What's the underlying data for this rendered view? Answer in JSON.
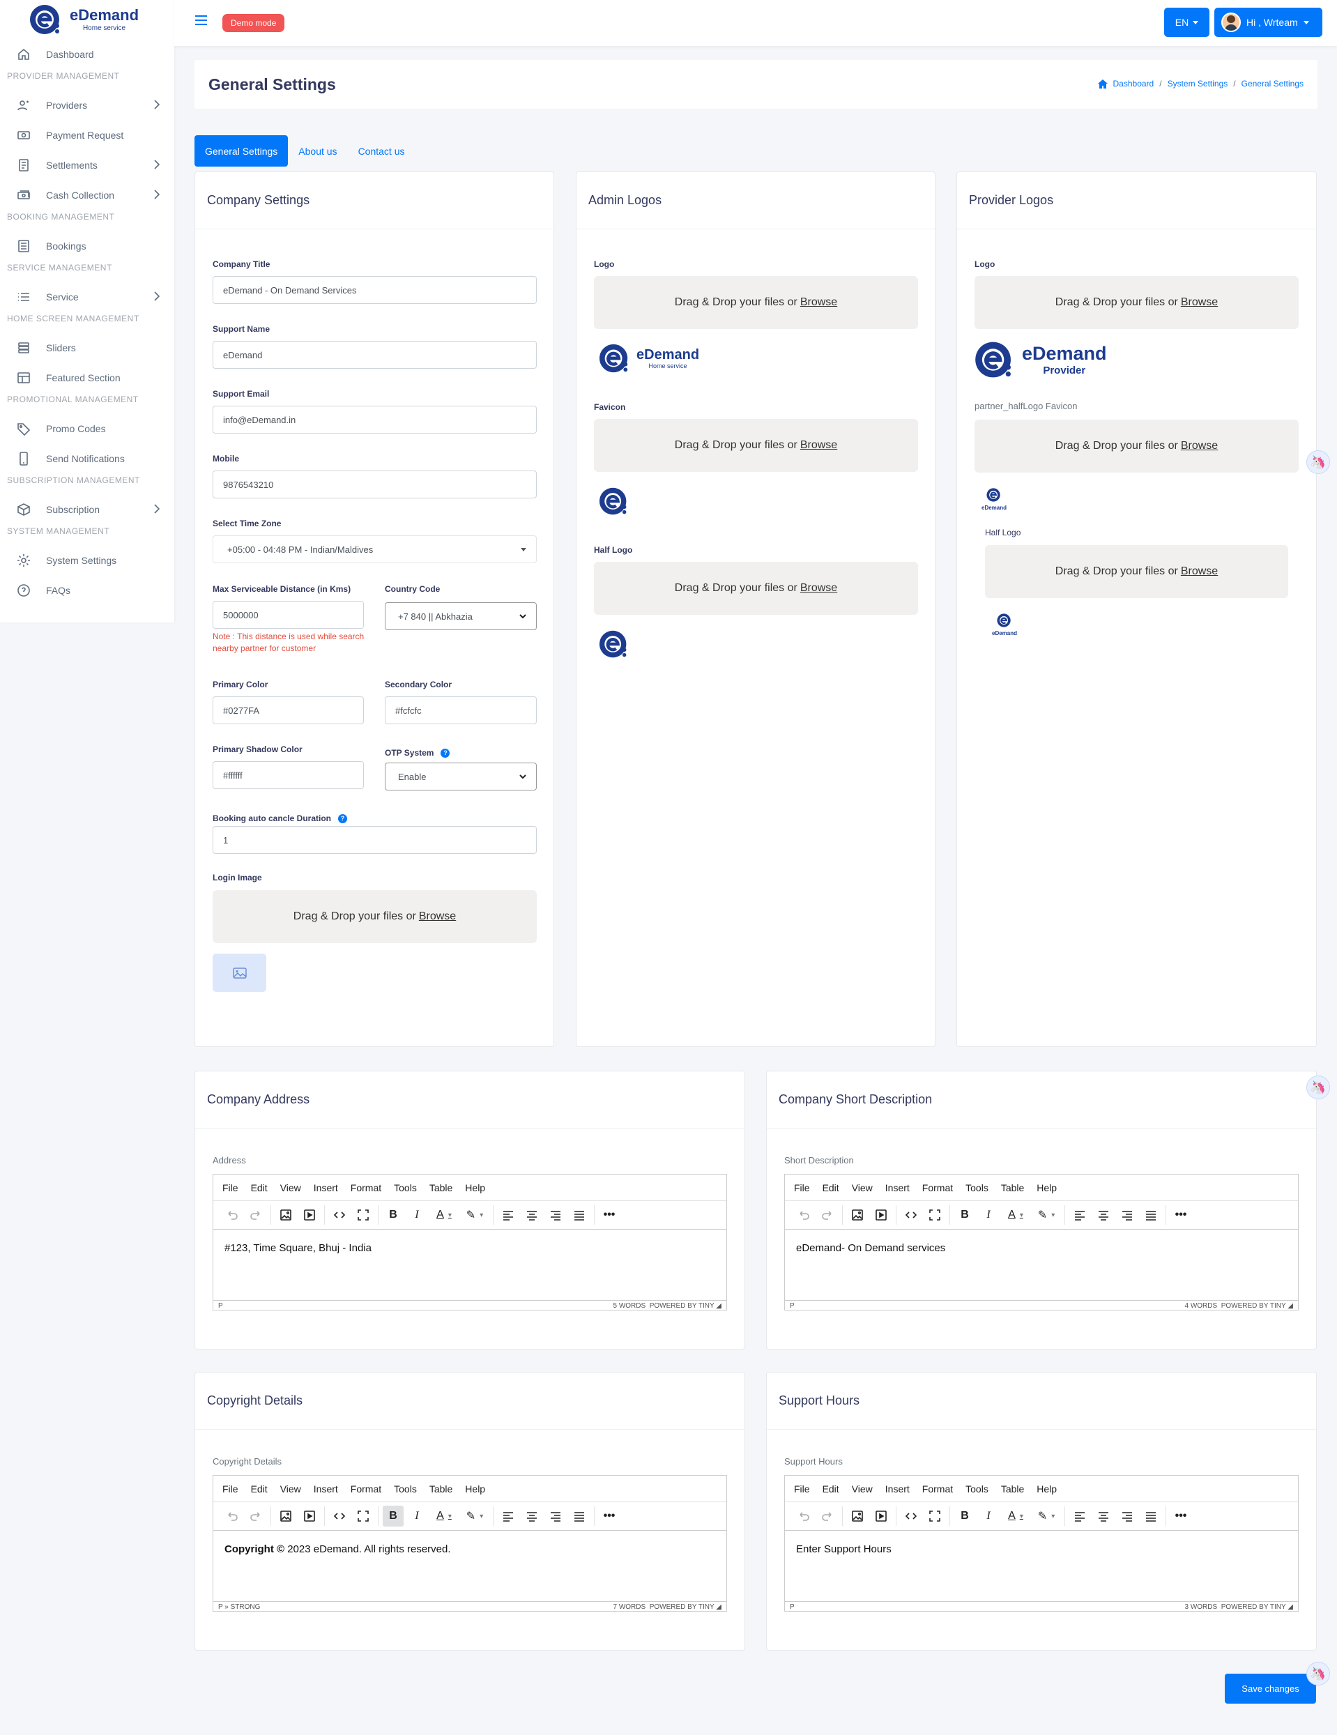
{
  "brand": {
    "name": "eDemand",
    "sub": "Home service"
  },
  "sidebar": {
    "dashboard": "Dashboard",
    "sections": [
      {
        "title": "PROVIDER MANAGEMENT",
        "items": [
          "Providers",
          "Payment Request",
          "Settlements",
          "Cash Collection"
        ]
      },
      {
        "title": "BOOKING MANAGEMENT",
        "items": [
          "Bookings"
        ]
      },
      {
        "title": "SERVICE MANAGEMENT",
        "items": [
          "Service"
        ]
      },
      {
        "title": "HOME SCREEN MANAGEMENT",
        "items": [
          "Sliders",
          "Featured Section"
        ]
      },
      {
        "title": "PROMOTIONAL MANAGEMENT",
        "items": [
          "Promo Codes",
          "Send Notifications"
        ]
      },
      {
        "title": "SUBSCRIPTION MANAGEMENT",
        "items": [
          "Subscription"
        ]
      },
      {
        "title": "SYSTEM MANAGEMENT",
        "items": [
          "System Settings",
          "FAQs"
        ]
      }
    ]
  },
  "topbar": {
    "demo": "Demo mode",
    "lang": "EN",
    "user": "Hi , Wrteam"
  },
  "page": {
    "title": "General Settings",
    "breadcrumb": [
      "Dashboard",
      "System Settings",
      "General Settings"
    ]
  },
  "tabs": [
    "General Settings",
    "About us",
    "Contact us"
  ],
  "company": {
    "heading": "Company Settings",
    "title_label": "Company Title",
    "title_value": "eDemand - On Demand Services",
    "support_name_label": "Support Name",
    "support_name_value": "eDemand",
    "support_email_label": "Support Email",
    "support_email_value": "info@eDemand.in",
    "mobile_label": "Mobile",
    "mobile_value": "9876543210",
    "tz_label": "Select Time Zone",
    "tz_value": "+05:00 - 04:48 PM - Indian/Maldives",
    "distance_label": "Max Serviceable Distance (in Kms)",
    "distance_value": "5000000",
    "distance_note": "Note : This distance is used while search nearby partner for customer",
    "country_label": "Country Code",
    "country_value": "+7 840 || Abkhazia",
    "primary_label": "Primary Color",
    "primary_value": "#0277FA",
    "secondary_label": "Secondary Color",
    "secondary_value": "#fcfcfc",
    "shadow_label": "Primary Shadow Color",
    "shadow_value": "#ffffff",
    "otp_label": "OTP System",
    "otp_value": "Enable",
    "cancel_label": "Booking auto cancle Duration",
    "cancel_value": "1",
    "login_image_label": "Login Image"
  },
  "drop": {
    "text": "Drag & Drop your files or",
    "browse": "Browse"
  },
  "admin_logos": {
    "heading": "Admin Logos",
    "logo": "Logo",
    "favicon": "Favicon",
    "half": "Half Logo"
  },
  "provider_logos": {
    "heading": "Provider Logos",
    "logo": "Logo",
    "brand": "eDemand",
    "brand_sub": "Provider",
    "favicon": "partner_halfLogo Favicon",
    "half": "Half Logo",
    "mini": "eDemand"
  },
  "editor_menu": [
    "File",
    "Edit",
    "View",
    "Insert",
    "Format",
    "Tools",
    "Table",
    "Help"
  ],
  "editors": [
    {
      "heading": "Company Address",
      "label": "Address",
      "content": "#123, Time Square, Bhuj - India",
      "path": "P",
      "words": "5 WORDS",
      "powered": "POWERED BY TINY"
    },
    {
      "heading": "Company Short Description",
      "label": "Short Description",
      "content": "eDemand- On Demand services",
      "path": "P",
      "words": "4 WORDS",
      "powered": "POWERED BY TINY"
    },
    {
      "heading": "Copyright Details",
      "label": "Copyright Details",
      "content_bold": "Copyright ©",
      "content": " 2023 eDemand. All rights reserved.",
      "path": "P » STRONG",
      "words": "7 WORDS",
      "powered": "POWERED BY TINY"
    },
    {
      "heading": "Support Hours",
      "label": "Support Hours",
      "content": "Enter Support Hours",
      "path": "P",
      "words": "3 WORDS",
      "powered": "POWERED BY TINY"
    }
  ],
  "save": "Save changes",
  "colors": {
    "accent": "#0277fa",
    "brand": "#1d3c8f",
    "demo": "#f05454"
  }
}
